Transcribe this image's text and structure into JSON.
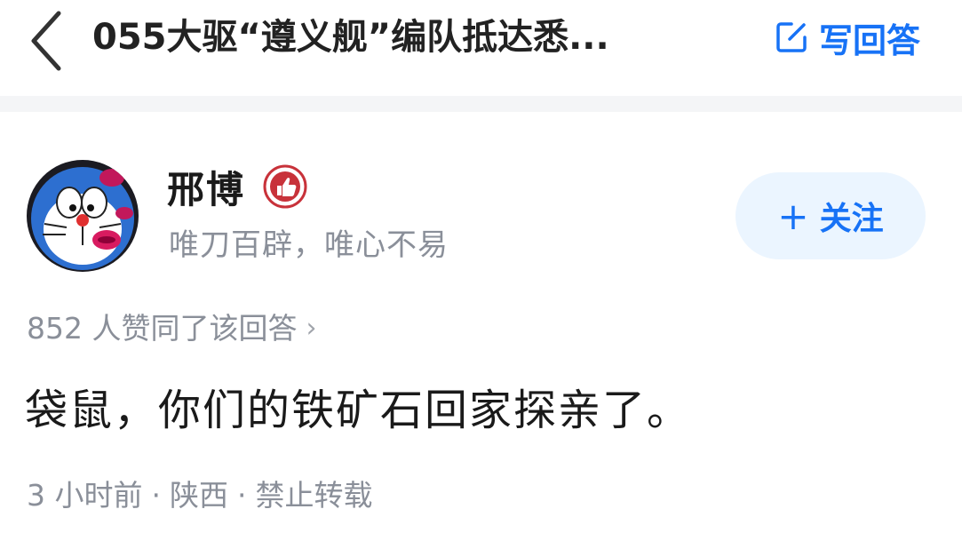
{
  "header": {
    "title": "055大驱“遵义舰”编队抵达悉...",
    "write_answer_label": "写回答"
  },
  "author": {
    "name": "邢博",
    "bio": "唯刀百辟，唯心不易",
    "follow_label": "关注",
    "follow_plus": "+"
  },
  "answer": {
    "upvote_text": "852 人赞同了该回答",
    "upvote_chevron": "›",
    "content": "袋鼠，你们的铁矿石回家探亲了。",
    "meta": {
      "time": "3 小时前",
      "location": "陕西",
      "rights": "禁止转载",
      "separator": "·"
    }
  },
  "icons": {
    "back": "chevron-left-icon",
    "write": "edit-icon",
    "badge": "thumbs-up-badge-icon"
  },
  "colors": {
    "accent": "#1772f6",
    "follow_bg": "#ebf5ff",
    "muted_text": "#8a8f99",
    "badge_red": "#c8323a"
  }
}
